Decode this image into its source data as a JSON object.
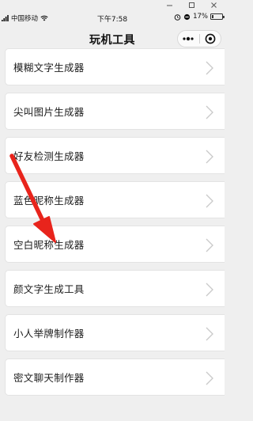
{
  "window": {
    "controls": [
      {
        "name": "minimize",
        "glyph": "—"
      },
      {
        "name": "maximize",
        "glyph": "☐"
      },
      {
        "name": "close",
        "glyph": "✕"
      }
    ]
  },
  "status_bar": {
    "carrier": "中国移动",
    "time": "下午7:58",
    "battery_percent": "17%",
    "battery_level": 0.17
  },
  "nav": {
    "title": "玩机工具",
    "more_icon": "more-dots-icon",
    "close_icon": "target-circle-icon"
  },
  "items": [
    {
      "label": "模糊文字生成器"
    },
    {
      "label": "尖叫图片生成器"
    },
    {
      "label": "好友检测生成器"
    },
    {
      "label": "蓝色昵称生成器"
    },
    {
      "label": "空白昵称生成器"
    },
    {
      "label": "颜文字生成工具"
    },
    {
      "label": "小人举牌制作器"
    },
    {
      "label": "密文聊天制作器"
    }
  ],
  "colors": {
    "background": "#efefef",
    "item_background": "#ffffff",
    "arrow": "#e8241c"
  },
  "annotation": {
    "type": "arrow",
    "points_to": "空白昵称生成器"
  }
}
